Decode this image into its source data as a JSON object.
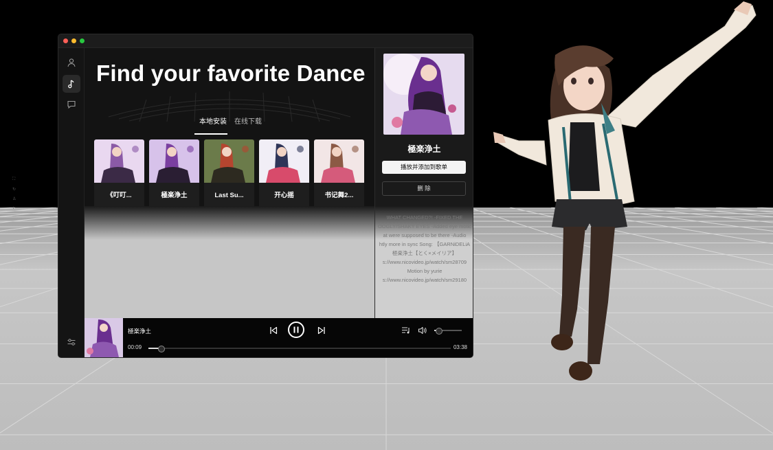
{
  "app": {
    "headline": "Find your favorite Dance"
  },
  "tabs": [
    {
      "label": "本地安装",
      "active": true
    },
    {
      "label": "在线下载",
      "active": false
    }
  ],
  "cards": [
    {
      "label": "《叮叮...",
      "palette": [
        "#e9d8f0",
        "#8b5aa6",
        "#3b2a46"
      ]
    },
    {
      "label": "極楽浄土",
      "palette": [
        "#d7c2ea",
        "#7a3fa0",
        "#2a1e33"
      ]
    },
    {
      "label": "Last Su...",
      "palette": [
        "#6b7b4a",
        "#b5452f",
        "#2d2a20"
      ]
    },
    {
      "label": "开心摇",
      "palette": [
        "#f1eef6",
        "#2f3558",
        "#d84b6b"
      ]
    },
    {
      "label": "书记舞2...",
      "palette": [
        "#f2e6e6",
        "#8c5a45",
        "#d55b7b"
      ]
    }
  ],
  "detail": {
    "title": "極楽浄土",
    "play_add_label": "播放并添加到歌单",
    "delete_label": "删 除",
    "description_lines": [
      "WHAT CHANGED?! -FIXED THE",
      "OOGLY/SHAKY EYES -Added eye motic",
      "at were supposed to be there -Audio",
      "htly more in sync Song: 【GARNiDELiA",
      "極楽浄土【とく×メイリア】",
      "s://www.nicovideo.jp/watch/sm28709",
      "Motion by yurie",
      "s://www.nicovideo.jp/watch/sm29180"
    ]
  },
  "player": {
    "title": "極楽浄土",
    "current_time": "00:09",
    "total_time": "03:38",
    "progress": 0.041,
    "volume": 0.15
  },
  "colors": {
    "accent": "#ffffff",
    "window_bg": "#151515"
  }
}
